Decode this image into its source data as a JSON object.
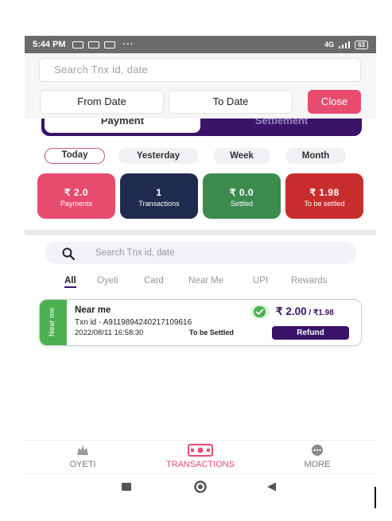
{
  "status_bar": {
    "time": "5:44 PM",
    "dots": "···",
    "battery": "63",
    "network": "4G"
  },
  "filter": {
    "search_placeholder": "Search Tnx id, date",
    "from_date": "From Date",
    "to_date": "To Date",
    "close": "Close"
  },
  "tabs": {
    "payment": "Payment",
    "settlement": "Settlement"
  },
  "periods": [
    "Today",
    "Yesterday",
    "Week",
    "Month"
  ],
  "summary": [
    {
      "amount": "₹ 2.0",
      "label": "Payments",
      "color": "#e74c6f"
    },
    {
      "amount": "1",
      "label": "Transactions",
      "color": "#1e2b4e"
    },
    {
      "amount": "₹ 0.0",
      "label": "Settled",
      "color": "#3d8a4f"
    },
    {
      "amount": "₹ 1.98",
      "label": "To be settled",
      "color": "#c82d2d"
    }
  ],
  "search": {
    "placeholder": "Search Tnx id, date"
  },
  "filter_tabs": [
    "All",
    "Oyeti",
    "Card",
    "Near Me",
    "UPI",
    "Rewards"
  ],
  "transaction": {
    "side_label": "Near me",
    "title": "Near me",
    "txn_id": "Txn id - A9119894240217109616",
    "datetime": "2022/08/11 16:58:30",
    "status": "To be Settled",
    "amount": "₹ 2.00",
    "net_amount": " / ₹1.98",
    "refund": "Refund"
  },
  "bottom_nav": [
    "OYETI",
    "TRANSACTIONS",
    "MORE"
  ],
  "colors": {
    "accent": "#e74c6f",
    "brand_purple": "#3a1468",
    "success": "#4cb050"
  }
}
